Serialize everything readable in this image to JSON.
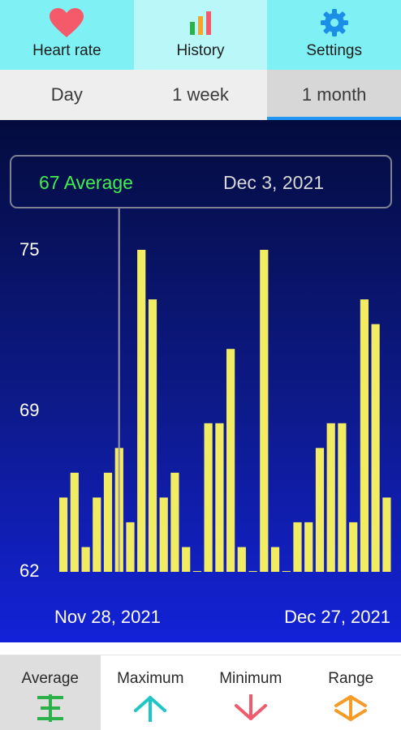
{
  "top_nav": {
    "tabs": [
      {
        "label": "Heart rate",
        "icon": "heart-icon",
        "active": false
      },
      {
        "label": "History",
        "icon": "bar-chart-icon",
        "active": true
      },
      {
        "label": "Settings",
        "icon": "gear-icon",
        "active": false
      }
    ]
  },
  "period_tabs": [
    "Day",
    "1 week",
    "1 month"
  ],
  "selected_period": "1 month",
  "tooltip": {
    "average_text": "67 Average",
    "date_text": "Dec 3, 2021"
  },
  "chart_data": {
    "type": "bar",
    "x_start_label": "Nov 28, 2021",
    "x_end_label": "Dec 27, 2021",
    "y_tick_labels": [
      "75",
      "69",
      "62"
    ],
    "ylim": [
      62,
      75
    ],
    "values": [
      65,
      66,
      63,
      65,
      66,
      67,
      64,
      75,
      73,
      65,
      66,
      63,
      62,
      68,
      68,
      71,
      63,
      62,
      75,
      63,
      62,
      64,
      64,
      67,
      68,
      68,
      64,
      73,
      72,
      65
    ],
    "highlight_index": 5,
    "bar_color": "#f2ec63",
    "cursor_color": "#9a9aa8"
  },
  "bottom_nav": {
    "tabs": [
      {
        "label": "Average",
        "icon": "average-icon",
        "active": true
      },
      {
        "label": "Maximum",
        "icon": "arrow-up-icon",
        "active": false
      },
      {
        "label": "Minimum",
        "icon": "arrow-down-icon",
        "active": false
      },
      {
        "label": "Range",
        "icon": "range-icon",
        "active": false
      }
    ]
  },
  "colors": {
    "heart": "#f55a6b",
    "gear": "#1a8fe8",
    "average_icon": "#2bb04a",
    "maximum_icon": "#1fc6c6",
    "minimum_icon": "#ef5b6a",
    "range_icon": "#f59c28",
    "tab_underline": "#2196f3"
  }
}
